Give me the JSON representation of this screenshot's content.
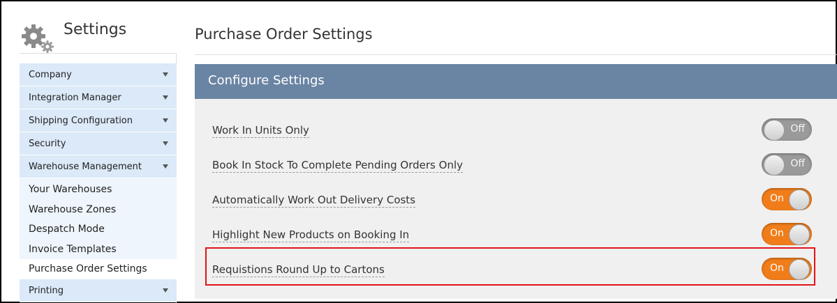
{
  "sidebar": {
    "title": "Settings",
    "items": [
      {
        "label": "Company"
      },
      {
        "label": "Integration Manager"
      },
      {
        "label": "Shipping Configuration"
      },
      {
        "label": "Security"
      },
      {
        "label": "Warehouse Management"
      }
    ],
    "subitems": [
      {
        "label": "Your Warehouses"
      },
      {
        "label": "Warehouse Zones"
      },
      {
        "label": "Despatch Mode"
      },
      {
        "label": "Invoice Templates"
      },
      {
        "label": "Purchase Order Settings",
        "active": true
      }
    ],
    "bottom_item": {
      "label": "Printing"
    }
  },
  "main": {
    "page_title": "Purchase Order Settings",
    "panel_title": "Configure Settings",
    "settings": [
      {
        "label": "Work In Units Only",
        "state": "Off"
      },
      {
        "label": "Book In Stock To Complete Pending Orders Only",
        "state": "Off"
      },
      {
        "label": "Automatically Work Out Delivery Costs",
        "state": "On"
      },
      {
        "label": "Highlight New Products on Booking In",
        "state": "On"
      },
      {
        "label": "Requistions Round Up to Cartons",
        "state": "On",
        "highlighted": true
      }
    ]
  },
  "colors": {
    "panel_header": "#6a84a3",
    "toggle_on": "#f07d1a",
    "toggle_off": "#9a9a9a",
    "sidebar_item": "#dbe9f8",
    "highlight_box": "#e0141a"
  },
  "icons": {
    "header": "gear-icon",
    "dropdown": "caret-down-icon"
  }
}
